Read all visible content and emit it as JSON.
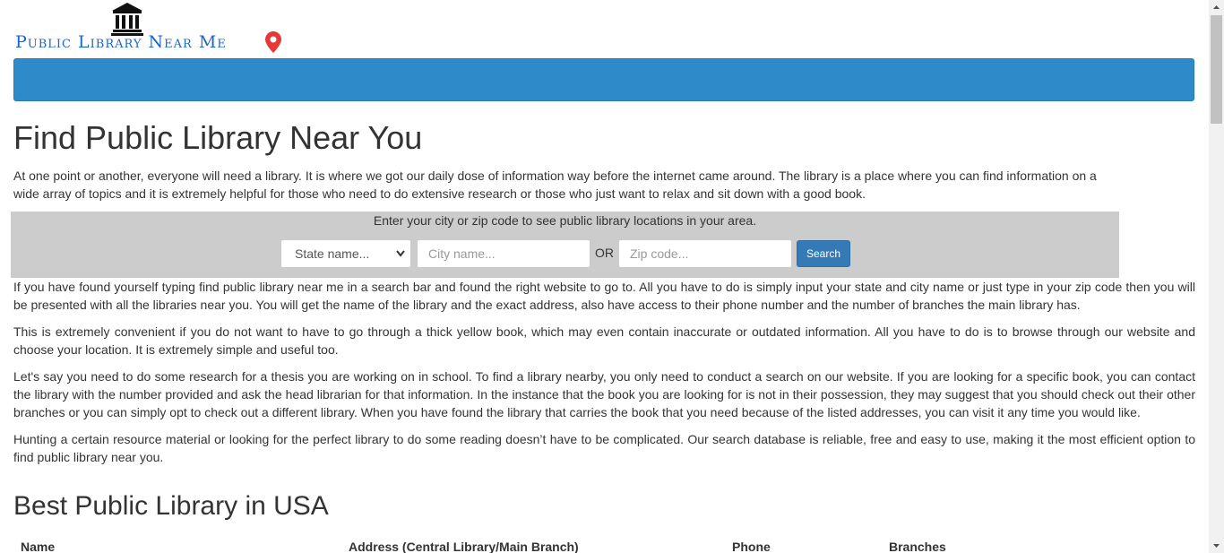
{
  "header": {
    "logo_text": "Public Library Near Me",
    "logo_icon": "library-building-icon",
    "pin_icon": "map-pin-icon",
    "brand_color": "#1b66c9",
    "pin_color": "#e53935"
  },
  "navbar": {
    "color": "#2f8ac9"
  },
  "main": {
    "title": "Find Public Library Near You",
    "intro": "At one point or another, everyone will need a library. It is where we got our daily dose of information way before the internet came around. The library is a place where you can find information on a wide array of topics and it is extremely helpful for those who need to do extensive research or those who just want to relax and sit down with a good book.",
    "search": {
      "hint": "Enter your city or zip code to see public library locations in your area.",
      "state_placeholder": "State name...",
      "city_placeholder": "City name...",
      "or_label": "OR",
      "zip_placeholder": "Zip code...",
      "button_label": "Search",
      "button_color": "#337ab7"
    },
    "paragraphs": [
      "If you have found yourself typing find public library near me in a search bar and found the right website to go to. All you have to do is simply input your state and city name or just type in your zip code then you will be presented with all the libraries near you. You will get the name of the library and the exact address, also have access to their phone number and the number of branches the main library has.",
      "This is extremely convenient if you do not want to have to go through a thick yellow book, which may even contain inaccurate or outdated information. All you have to do is to browse through our website and choose your location. It is extremely simple and useful too.",
      "Let's say you need to do some research for a thesis you are working on in school. To find a library nearby, you only need to conduct a search on our website. If you are looking for a specific book, you can contact the library with the number provided and ask the head librarian for that information. In the instance that the book you are looking for is not in their possession, they may suggest that you should check out their other branches or you can simply opt to check out a different library. When you have found the library that carries the book that you need because of the listed addresses, you can visit it any time you would like.",
      "Hunting a certain resource material or looking for the perfect library to do some reading doesn’t have to be complicated. Our search database is reliable, free and easy to use, making it the most efficient option to find public library near you."
    ],
    "section_title": "Best Public Library in USA",
    "table": {
      "columns": [
        "Name",
        "Address (Central Library/Main Branch)",
        "Phone",
        "Branches"
      ]
    }
  }
}
